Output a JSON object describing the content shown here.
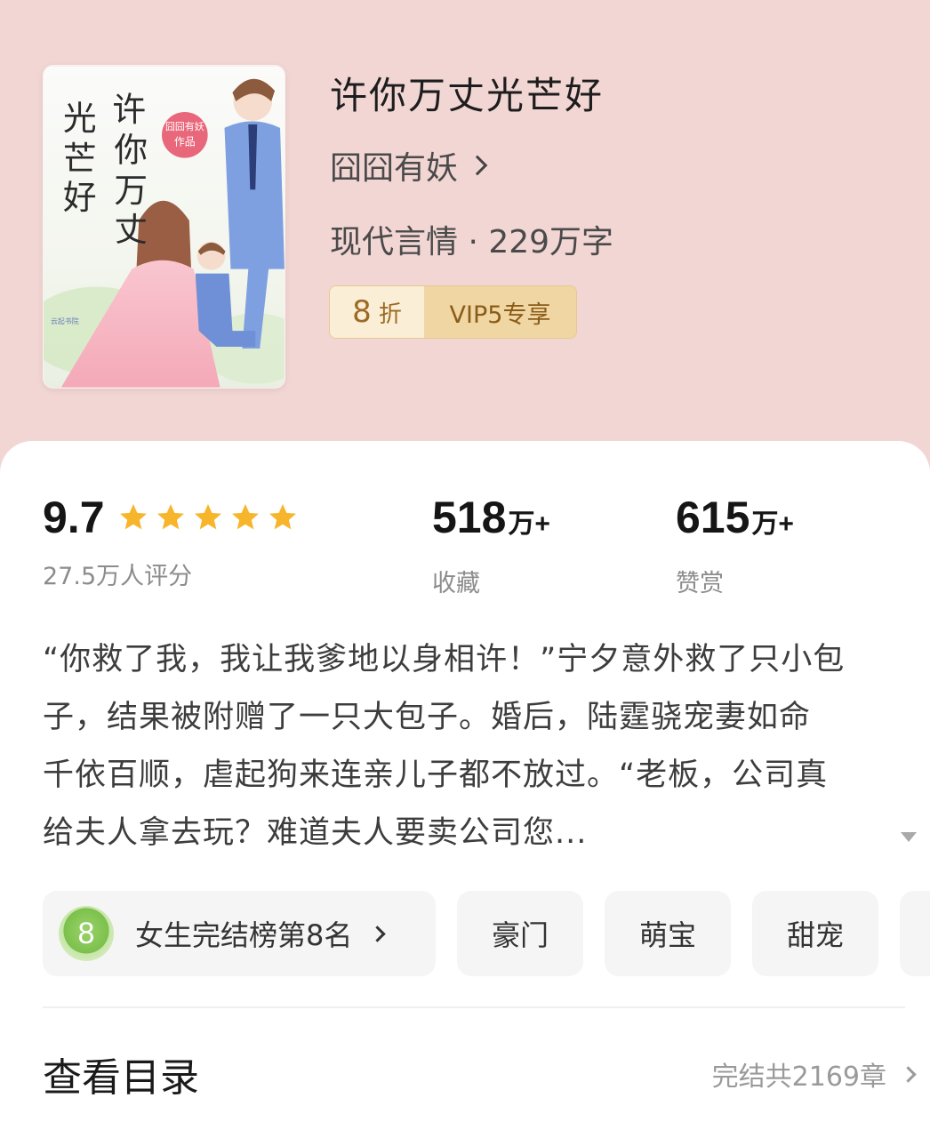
{
  "book": {
    "title": "许你万丈光芒好",
    "author": "囧囧有妖",
    "meta": "现代言情 · 229万字",
    "discount_num": "8",
    "discount_unit": "折",
    "vip_label": "VIP5专享",
    "cover": {
      "title_chars": [
        "许",
        "你",
        "万",
        "丈",
        "光",
        "芒",
        "好"
      ],
      "stamp_line1": "囧囧有妖",
      "stamp_line2": "作品",
      "publisher": "云起书院"
    }
  },
  "stats": {
    "rating": "9.7",
    "rating_stars": 5,
    "rating_count": "27.5万人评分",
    "collect_num": "518",
    "collect_unit": "万+",
    "collect_label": "收藏",
    "reward_num": "615",
    "reward_unit": "万+",
    "reward_label": "赞赏"
  },
  "description": {
    "lines": [
      "“你救了我，我让我爹地以身相许！”宁夕意外救了只小包",
      "子，结果被附赠了一只大包子。婚后，陆霆骁宠妻如命",
      "千依百顺，虐起狗来连亲儿子都不放过。“老板，公司真",
      "给夫人拿去玩？难道夫人要卖公司您..."
    ],
    "expand_icon": "triangle-down-icon"
  },
  "tags": {
    "rank_number": "8",
    "rank_label": "女生完结榜第8名",
    "items": [
      "豪门",
      "萌宝",
      "甜宠"
    ]
  },
  "toc": {
    "title": "查看目录",
    "count": "完结共2169章"
  },
  "colors": {
    "header_bg": "#f2d6d4",
    "star": "#f7b52c",
    "vip_gold": "#f0d6a3",
    "medal_green": "#7cc04c"
  }
}
